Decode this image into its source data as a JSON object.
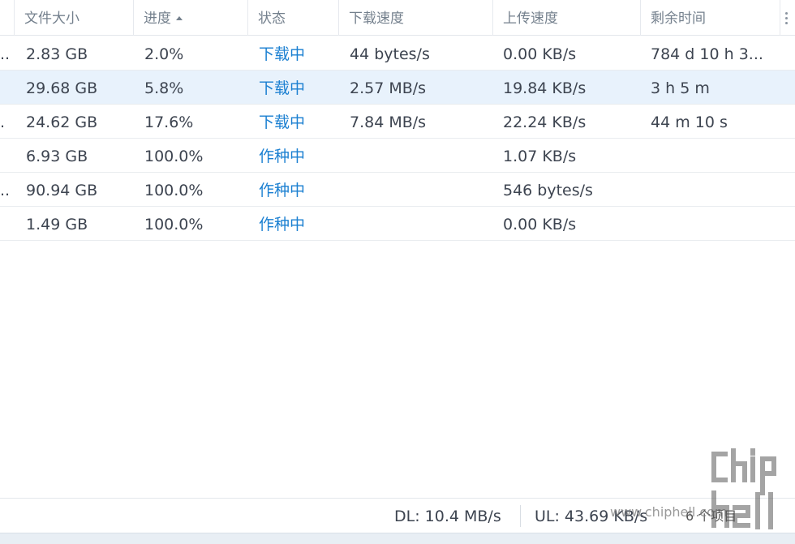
{
  "header": {
    "columns": [
      {
        "label": "文件大小"
      },
      {
        "label": "进度"
      },
      {
        "label": "状态"
      },
      {
        "label": "下载速度"
      },
      {
        "label": "上传速度"
      },
      {
        "label": "剩余时间"
      }
    ]
  },
  "rows": [
    {
      "name": "..",
      "size": "2.83 GB",
      "progress": "2.0%",
      "status": "下载中",
      "download": "44 bytes/s",
      "upload": "0.00 KB/s",
      "remaining": "784 d 10 h 3..."
    },
    {
      "name": "",
      "size": "29.68 GB",
      "progress": "5.8%",
      "status": "下载中",
      "download": "2.57 MB/s",
      "upload": "19.84 KB/s",
      "remaining": "3 h 5 m"
    },
    {
      "name": ".",
      "size": "24.62 GB",
      "progress": "17.6%",
      "status": "下载中",
      "download": "7.84 MB/s",
      "upload": "22.24 KB/s",
      "remaining": "44 m 10 s"
    },
    {
      "name": "",
      "size": "6.93 GB",
      "progress": "100.0%",
      "status": "作种中",
      "download": "",
      "upload": "1.07 KB/s",
      "remaining": ""
    },
    {
      "name": "..",
      "size": "90.94 GB",
      "progress": "100.0%",
      "status": "作种中",
      "download": "",
      "upload": "546 bytes/s",
      "remaining": ""
    },
    {
      "name": "",
      "size": "1.49 GB",
      "progress": "100.0%",
      "status": "作种中",
      "download": "",
      "upload": "0.00 KB/s",
      "remaining": ""
    }
  ],
  "footer": {
    "dl": "DL: 10.4 MB/s",
    "ul": "UL: 43.69 KB/s",
    "count": "6 个项目"
  },
  "watermark": {
    "text": "www.chiphell.com",
    "logo_text": "chip hell"
  },
  "colors": {
    "status_active": "#1a7fd1",
    "selected_row": "#e8f2fc"
  }
}
